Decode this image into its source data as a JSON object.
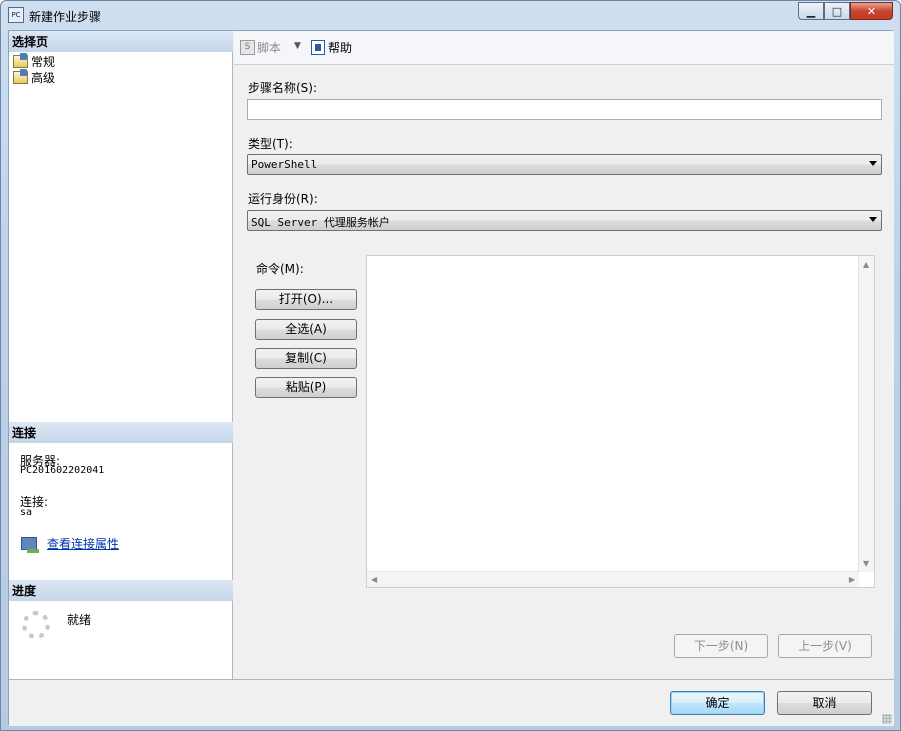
{
  "window": {
    "title": "新建作业步骤",
    "icon": "dialog-app-icon"
  },
  "left": {
    "select_page_header": "选择页",
    "pages": [
      {
        "label": "常规",
        "icon": "page-icon"
      },
      {
        "label": "高级",
        "icon": "page-icon"
      }
    ],
    "connection_header": "连接",
    "server_label": "服务器:",
    "server_value": "PC201602202041",
    "connection_label": "连接:",
    "connection_value": "sa",
    "view_props_link": "查看连接属性",
    "progress_header": "进度",
    "progress_status": "就绪"
  },
  "toolbar": {
    "script_label": "脚本",
    "help_label": "帮助"
  },
  "form": {
    "step_name_label": "步骤名称(S):",
    "step_name_value": "",
    "type_label": "类型(T):",
    "type_value": "PowerShell",
    "run_as_label": "运行身份(R):",
    "run_as_value": "SQL Server 代理服务帐户",
    "command_label": "命令(M):",
    "command_value": "",
    "open_button": "打开(O)...",
    "select_all_button": "全选(A)",
    "copy_button": "复制(C)",
    "paste_button": "粘贴(P)",
    "next_button": "下一步(N)",
    "prev_button": "上一步(V)"
  },
  "footer": {
    "ok_button": "确定",
    "cancel_button": "取消"
  }
}
